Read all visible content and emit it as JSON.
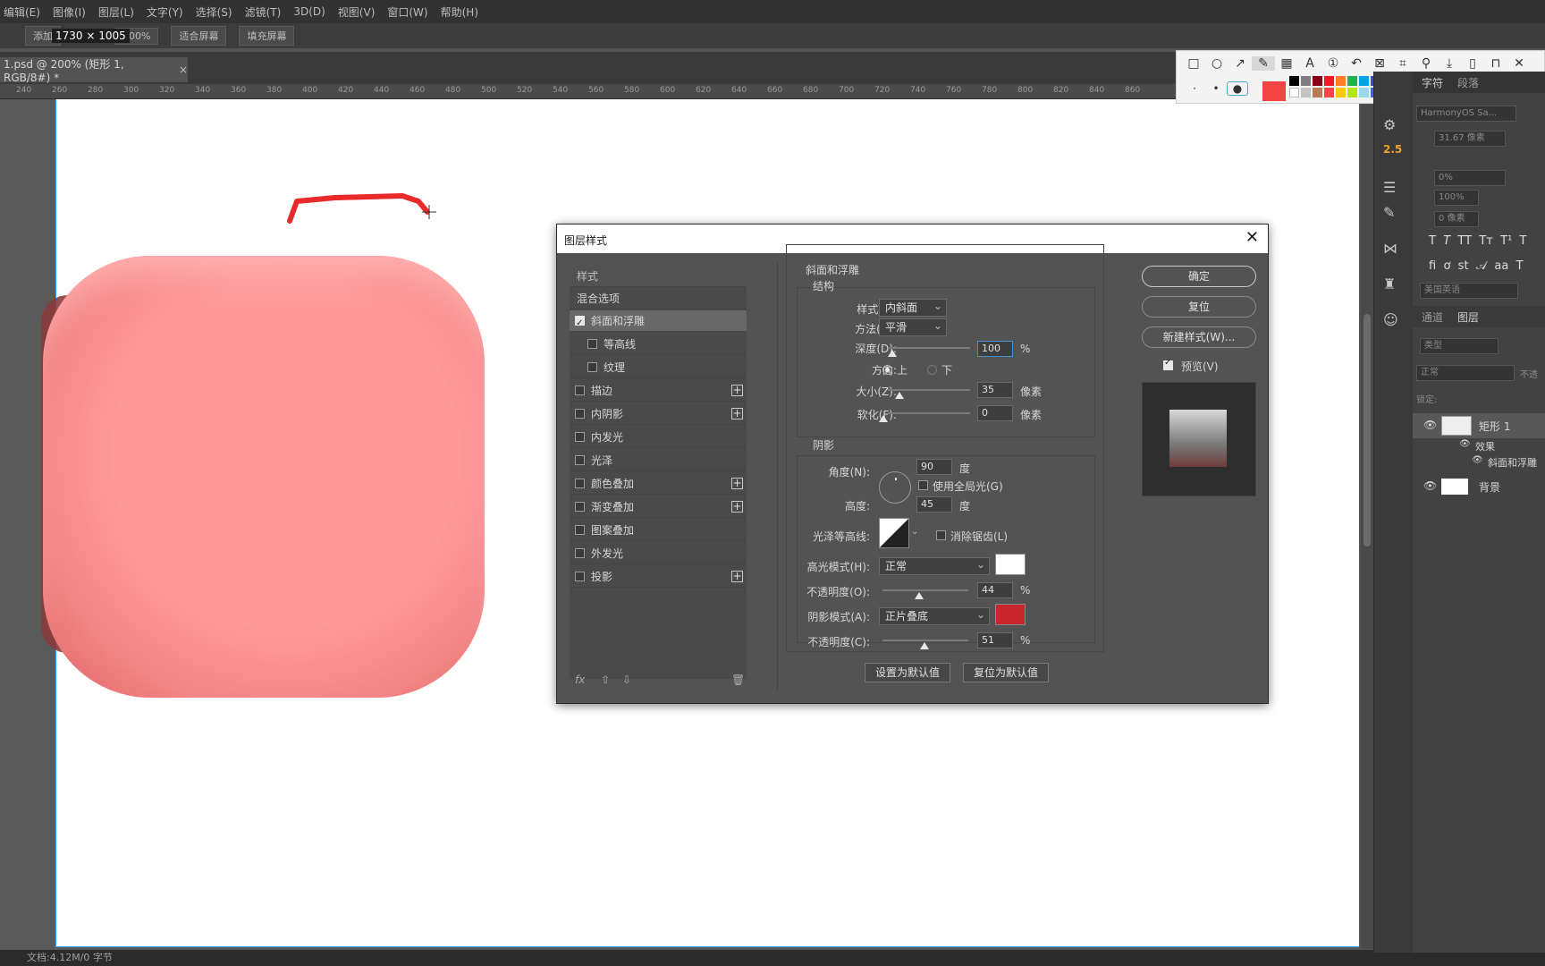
{
  "menubar": [
    "编辑(E)",
    "图像(I)",
    "图层(L)",
    "文字(Y)",
    "选择(S)",
    "滤镜(T)",
    "3D(D)",
    "视图(V)",
    "窗口(W)",
    "帮助(H)"
  ],
  "options": {
    "b1": "添加",
    "b2": "100%",
    "b3": "适合屏幕",
    "b4": "填充屏幕"
  },
  "dim_tip": "1730 × 1005",
  "doc_tab": "1.psd @ 200% (矩形 1, RGB/8#) *",
  "ruler_marks": [
    "240",
    "260",
    "280",
    "300",
    "320",
    "340",
    "360",
    "380",
    "400",
    "420",
    "440",
    "460",
    "480",
    "500",
    "520",
    "540",
    "560",
    "580",
    "600",
    "620",
    "640",
    "660",
    "680",
    "700",
    "720",
    "740",
    "760",
    "780",
    "800",
    "820",
    "840",
    "860"
  ],
  "status": "文档:4.12M/0 字节",
  "annot_swatch_colors": [
    "#000000",
    "#7f7f7f",
    "#880015",
    "#ed1c24",
    "#ff7f27",
    "#22b14c",
    "#00a2e8",
    "#3f48cc",
    "#a349a4",
    "#18b3b3",
    "#ffffff",
    "#c3c3c3",
    "#b97a57",
    "#ff4444",
    "#ffc90e",
    "#b5e61d",
    "#99d9ea",
    "#4060ff",
    "#c8bfe7",
    "#00d0ff"
  ],
  "right": {
    "tab_char": "字符",
    "tab_para": "段落",
    "font_field": "HarmonyOS Sa...",
    "size_field": "31.67 像素",
    "tracking": "0%",
    "scale": "100%",
    "baseline": "0 像素",
    "lang": "美国英语",
    "indicator": "2.5",
    "tab_channels": "通道",
    "tab_layers": "图层",
    "search": "类型",
    "blend": "正常",
    "opacity": "不透",
    "lock": "锁定:",
    "layer1": "矩形 1",
    "effects": "效果",
    "effect1": "斜面和浮雕",
    "bg": "背景"
  },
  "dialog": {
    "title": "图层样式",
    "list_header": "样式",
    "blend_options": "混合选项",
    "items": [
      {
        "label": "斜面和浮雕",
        "checked": true,
        "plus": false
      },
      {
        "label": "等高线",
        "checked": false,
        "plus": false
      },
      {
        "label": "纹理",
        "checked": false,
        "plus": false
      },
      {
        "label": "描边",
        "checked": false,
        "plus": true
      },
      {
        "label": "内阴影",
        "checked": false,
        "plus": true
      },
      {
        "label": "内发光",
        "checked": false,
        "plus": false
      },
      {
        "label": "光泽",
        "checked": false,
        "plus": false
      },
      {
        "label": "颜色叠加",
        "checked": false,
        "plus": true
      },
      {
        "label": "渐变叠加",
        "checked": false,
        "plus": true
      },
      {
        "label": "图案叠加",
        "checked": false,
        "plus": false
      },
      {
        "label": "外发光",
        "checked": false,
        "plus": false
      },
      {
        "label": "投影",
        "checked": false,
        "plus": true
      }
    ],
    "fx": "fx",
    "section": "斜面和浮雕",
    "structure": "结构",
    "style_label": "样式(T):",
    "style_value": "内斜面",
    "technique_label": "方法(Q):",
    "technique_value": "平滑",
    "depth_label": "深度(D):",
    "depth_value": "100",
    "depth_unit": "%",
    "direction_label": "方向:",
    "dir_up": "上",
    "dir_down": "下",
    "size_label": "大小(Z):",
    "size_value": "35",
    "size_unit": "像素",
    "soften_label": "软化(F):",
    "soften_value": "0",
    "soften_unit": "像素",
    "shading": "阴影",
    "angle_label": "角度(N):",
    "angle_value": "90",
    "angle_unit": "度",
    "global_light": "使用全局光(G)",
    "altitude_label": "高度:",
    "altitude_value": "45",
    "altitude_unit": "度",
    "gloss_label": "光泽等高线:",
    "antialias": "消除锯齿(L)",
    "hl_mode_label": "高光模式(H):",
    "hl_mode_value": "正常",
    "hl_color": "#ffffff",
    "opacity1_label": "不透明度(O):",
    "opacity1_value": "44",
    "opacity1_unit": "%",
    "sh_mode_label": "阴影模式(A):",
    "sh_mode_value": "正片叠底",
    "sh_color": "#c8282d",
    "opacity2_label": "不透明度(C):",
    "opacity2_value": "51",
    "opacity2_unit": "%",
    "make_default": "设置为默认值",
    "reset_default": "复位为默认值",
    "ok": "确定",
    "reset": "复位",
    "new_style": "新建样式(W)...",
    "preview": "预览(V)"
  }
}
